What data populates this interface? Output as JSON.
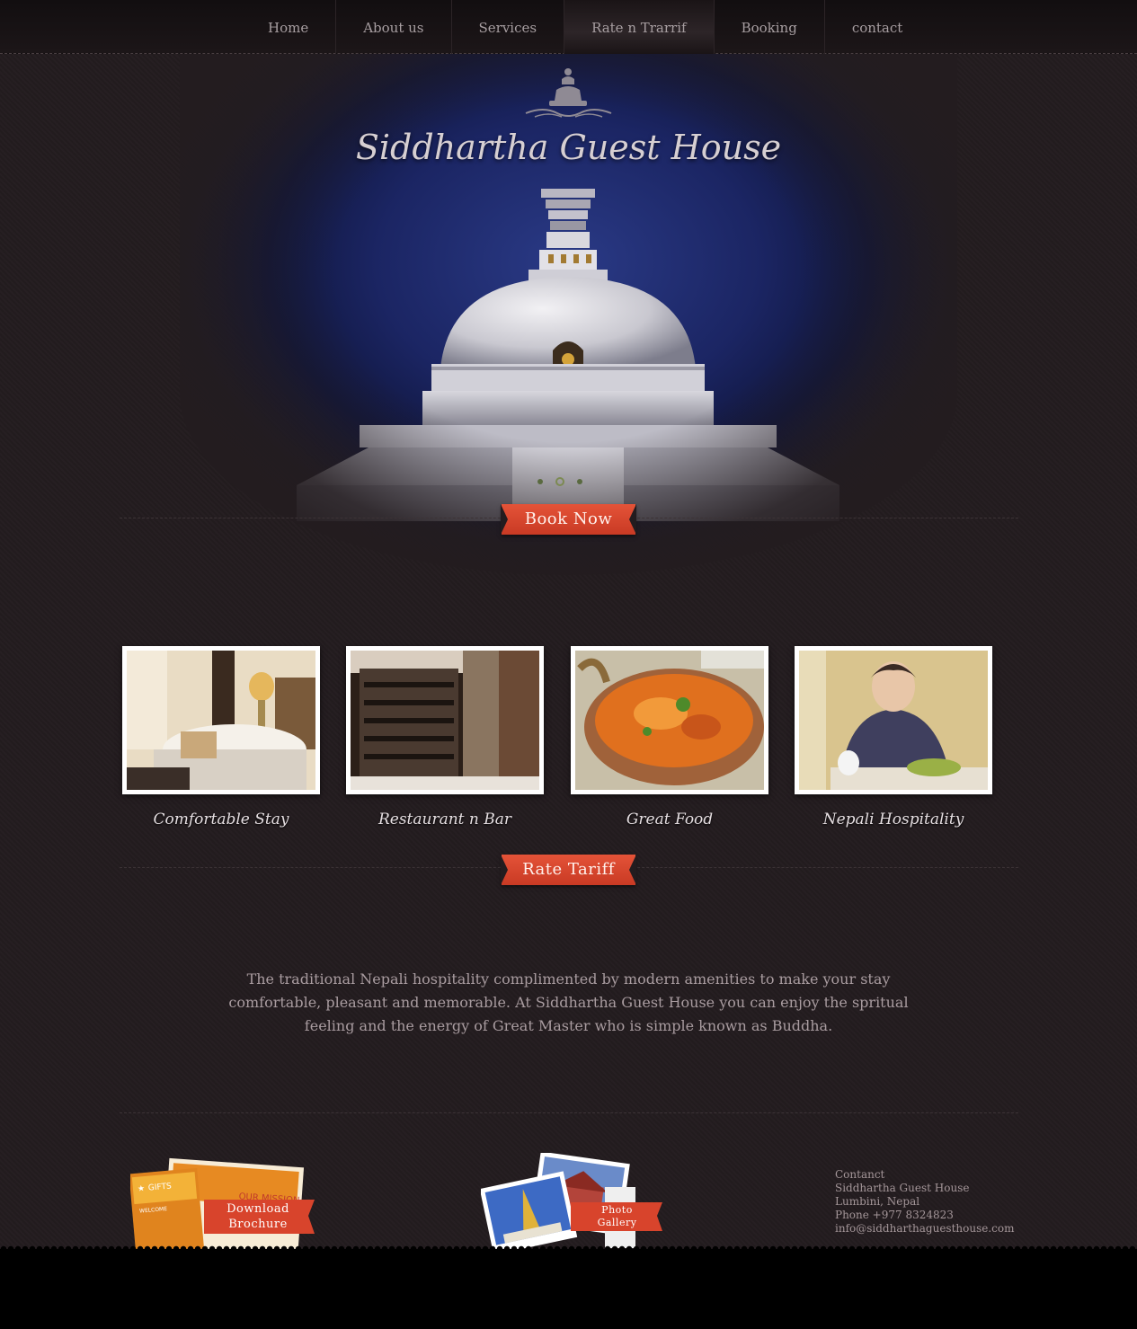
{
  "nav": {
    "items": [
      {
        "label": "Home"
      },
      {
        "label": "About us"
      },
      {
        "label": "Services"
      },
      {
        "label": "Rate n Trarrif"
      },
      {
        "label": "Booking"
      },
      {
        "label": "contact"
      }
    ],
    "active_index": 3
  },
  "hero": {
    "title": "Siddhartha Guest House",
    "slide_count": 3,
    "active_slide": 2,
    "book_now_label": "Book Now"
  },
  "features": [
    {
      "label": "Comfortable Stay"
    },
    {
      "label": "Restaurant n Bar"
    },
    {
      "label": "Great Food"
    },
    {
      "label": "Nepali Hospitality"
    }
  ],
  "rate_tariff_label": "Rate Tariff",
  "intro_text": "The traditional Nepali hospitality complimented by modern amenities to make your stay comfortable, pleasant and memorable. At Siddhartha Guest House you can enjoy the spritual feeling and the energy of Great Master who is simple known as Buddha.",
  "footer": {
    "brochure": {
      "line1": "Download",
      "line2": "Brochure",
      "card_text1": "GIFTS",
      "card_text2": "OUR MISSION",
      "card_text3": "WELCOME"
    },
    "gallery": {
      "line1": "Photo",
      "line2": "Gallery"
    },
    "contact": {
      "heading": "Contanct",
      "name": "Siddhartha Guest House",
      "address": "Lumbini, Nepal",
      "phone": "Phone +977 8324823",
      "email": "info@siddharthaguesthouse.com"
    }
  },
  "colors": {
    "background": "#231c1f",
    "accent": "#d8442c",
    "hero_sky": "#1b2563"
  }
}
